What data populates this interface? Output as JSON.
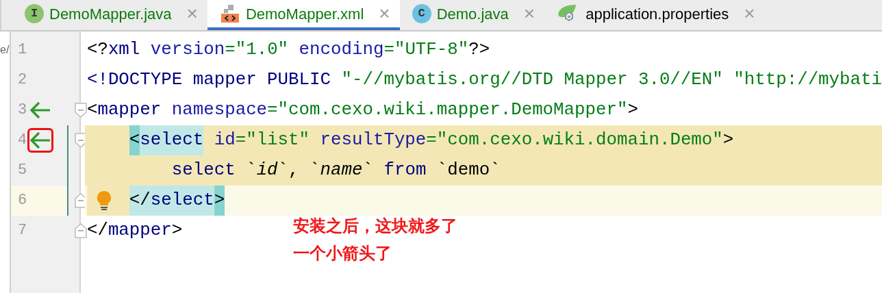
{
  "tabs": [
    {
      "label": "DemoMapper.java",
      "kind": "interface",
      "icon_letter": "I",
      "added": true,
      "selected": false,
      "close": "×"
    },
    {
      "label": "DemoMapper.xml",
      "kind": "xml",
      "added": true,
      "selected": true,
      "close": "×"
    },
    {
      "label": "Demo.java",
      "kind": "class",
      "icon_letter": "C",
      "added": true,
      "selected": false,
      "close": "×"
    },
    {
      "label": "application.properties",
      "kind": "properties",
      "added": false,
      "selected": false,
      "close": "×"
    }
  ],
  "side_fragment": "e/",
  "lines": [
    {
      "number": "1",
      "current": false,
      "injected": false,
      "tokens": [
        {
          "t": "<?",
          "kind": "punct"
        },
        {
          "t": "xml",
          "kind": "tag"
        },
        {
          "t": " version",
          "kind": "attr"
        },
        {
          "t": "=\"1.0\"",
          "kind": "string"
        },
        {
          "t": " encoding",
          "kind": "attr"
        },
        {
          "t": "=\"UTF-8\"",
          "kind": "string"
        },
        {
          "t": "?>",
          "kind": "punct"
        }
      ]
    },
    {
      "number": "2",
      "current": false,
      "injected": false,
      "tokens": [
        {
          "t": "<!DOCTYPE mapper PUBLIC",
          "kind": "tag"
        },
        {
          "t": " \"-//mybatis.org//DTD Mapper 3.0//EN\"",
          "kind": "string"
        },
        {
          "t": " \"http://mybati",
          "kind": "string"
        }
      ]
    },
    {
      "number": "3",
      "current": false,
      "injected": false,
      "nav_arrow": true,
      "fold_open": true,
      "tokens": [
        {
          "t": "<",
          "kind": "punct"
        },
        {
          "t": "mapper",
          "kind": "tag"
        },
        {
          "t": " namespace",
          "kind": "attr"
        },
        {
          "t": "=\"com.cexo.wiki.mapper.DemoMapper\"",
          "kind": "string"
        },
        {
          "t": ">",
          "kind": "punct"
        }
      ],
      "children": [
        {
          "number": "4",
          "current": false,
          "injected": true,
          "nav_arrow": true,
          "marker_highlighted": true,
          "fold_open": true,
          "changed": true,
          "tokens": [
            {
              "t": "<",
              "kind": "punct",
              "bracket_match": true
            },
            {
              "t": "select",
              "kind": "tag",
              "tag_match": true
            },
            {
              "t": " id",
              "kind": "attr"
            },
            {
              "t": "=\"list\"",
              "kind": "string"
            },
            {
              "t": " resultType",
              "kind": "attr"
            },
            {
              "t": "=\"com.cexo.wiki.domain.Demo\"",
              "kind": "string"
            },
            {
              "t": ">",
              "kind": "punct"
            }
          ],
          "children": [
            {
              "number": "5",
              "current": false,
              "injected": true,
              "changed": true,
              "tokens": [
                {
                  "t": "select",
                  "kind": "keyword"
                },
                {
                  "t": " `",
                  "kind": "text"
                },
                {
                  "t": "id",
                  "kind": "ident"
                },
                {
                  "t": "`, `",
                  "kind": "text"
                },
                {
                  "t": "name",
                  "kind": "ident"
                },
                {
                  "t": "`",
                  "kind": "text"
                },
                {
                  "t": " from",
                  "kind": "keyword"
                },
                {
                  "t": " `demo`",
                  "kind": "text"
                }
              ]
            }
          ]
        },
        {
          "number": "6",
          "current": true,
          "injected": false,
          "indent_injected": true,
          "fold_close": true,
          "changed": true,
          "bulb": true,
          "tokens": [
            {
              "t": "</",
              "kind": "punct",
              "tag_match": true
            },
            {
              "t": "select",
              "kind": "tag",
              "tag_match": true
            },
            {
              "t": ">",
              "kind": "punct",
              "bracket_match": true
            }
          ]
        }
      ]
    },
    {
      "number": "7",
      "current": false,
      "injected": false,
      "fold_close": true,
      "tokens": [
        {
          "t": "</",
          "kind": "punct"
        },
        {
          "t": "mapper",
          "kind": "tag"
        },
        {
          "t": ">",
          "kind": "punct"
        }
      ]
    }
  ],
  "annotation": {
    "lines": [
      "安装之后，这块就多了",
      "一个小箭头了"
    ]
  }
}
